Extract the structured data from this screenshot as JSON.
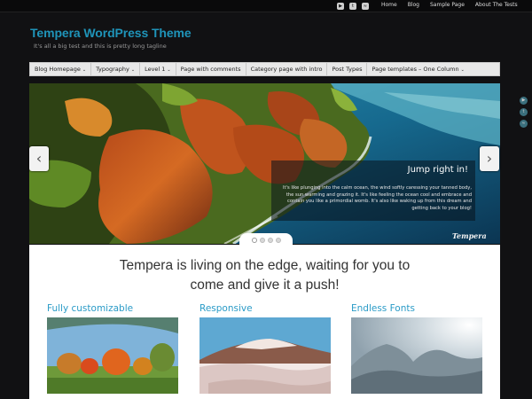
{
  "topbar": {
    "social_icons": [
      "youtube-icon",
      "twitter-icon",
      "rss-icon"
    ],
    "links": [
      "Home",
      "Blog",
      "Sample Page",
      "About The Tests"
    ]
  },
  "header": {
    "title": "Tempera WordPress Theme",
    "tagline": "It's all a big test and this is pretty long tagline"
  },
  "nav": {
    "items": [
      {
        "label": "Blog Homepage",
        "dropdown": true
      },
      {
        "label": "Typography",
        "dropdown": true
      },
      {
        "label": "Level 1",
        "dropdown": true
      },
      {
        "label": "Page with comments",
        "dropdown": false
      },
      {
        "label": "Category page with intro",
        "dropdown": false
      },
      {
        "label": "Post Types",
        "dropdown": false
      },
      {
        "label": "Page templates – One Column",
        "dropdown": true
      }
    ]
  },
  "slider": {
    "caption_title": "Jump right in!",
    "caption_text": "It's like plunging into the calm ocean, the wind softly caressing your tanned body, the sun warming and grazing it. It's like feeling the ocean cool and embrace and contain you like a primordial womb. It's also like waking up from this dream and getting back to your blog!",
    "watermark": "Tempera",
    "slide_count": 4,
    "active_slide": 1
  },
  "content": {
    "headline_line1": "Tempera is living on the edge, waiting for you to",
    "headline_line2": "come and give it a push!",
    "columns": [
      {
        "title": "Fully customizable"
      },
      {
        "title": "Responsive"
      },
      {
        "title": "Endless Fonts"
      }
    ]
  },
  "colors": {
    "accent": "#2a9bc7",
    "title": "#1f94b9",
    "background": "#111113"
  }
}
